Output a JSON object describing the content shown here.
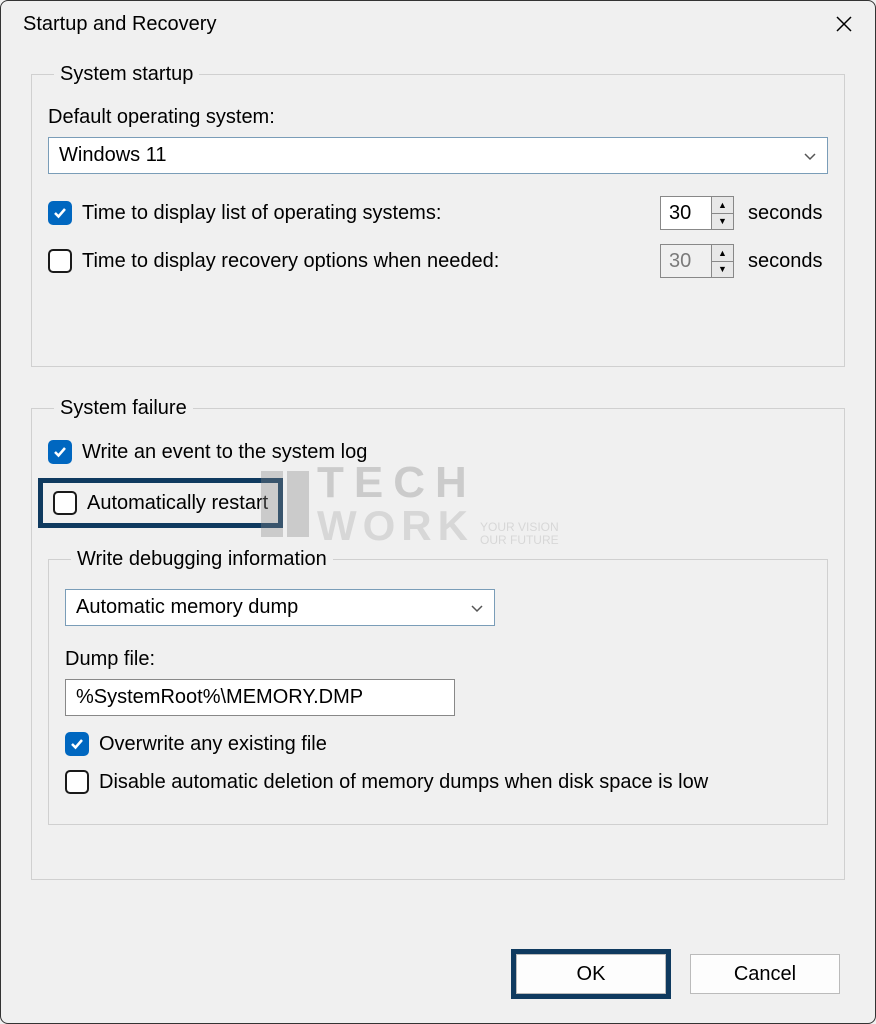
{
  "title": "Startup and Recovery",
  "system_startup": {
    "legend": "System startup",
    "default_os_label": "Default operating system:",
    "default_os_value": "Windows 11",
    "time_os_list": {
      "checked": true,
      "label": "Time to display list of operating systems:",
      "value": "30",
      "unit": "seconds"
    },
    "time_recovery": {
      "checked": false,
      "label": "Time to display recovery options when needed:",
      "value": "30",
      "unit": "seconds"
    }
  },
  "system_failure": {
    "legend": "System failure",
    "write_event": {
      "checked": true,
      "label": "Write an event to the system log"
    },
    "auto_restart": {
      "checked": false,
      "label": "Automatically restart"
    },
    "debug_legend": "Write debugging information",
    "debug_type": "Automatic memory dump",
    "dump_file_label": "Dump file:",
    "dump_file_value": "%SystemRoot%\\MEMORY.DMP",
    "overwrite": {
      "checked": true,
      "label": "Overwrite any existing file"
    },
    "disable_auto_delete": {
      "checked": false,
      "label": "Disable automatic deletion of memory dumps when disk space is low"
    }
  },
  "buttons": {
    "ok": "OK",
    "cancel": "Cancel"
  },
  "watermark": {
    "top": "TECH",
    "bottom": "WORK",
    "tagline1": "YOUR VISION",
    "tagline2": "OUR FUTURE"
  }
}
